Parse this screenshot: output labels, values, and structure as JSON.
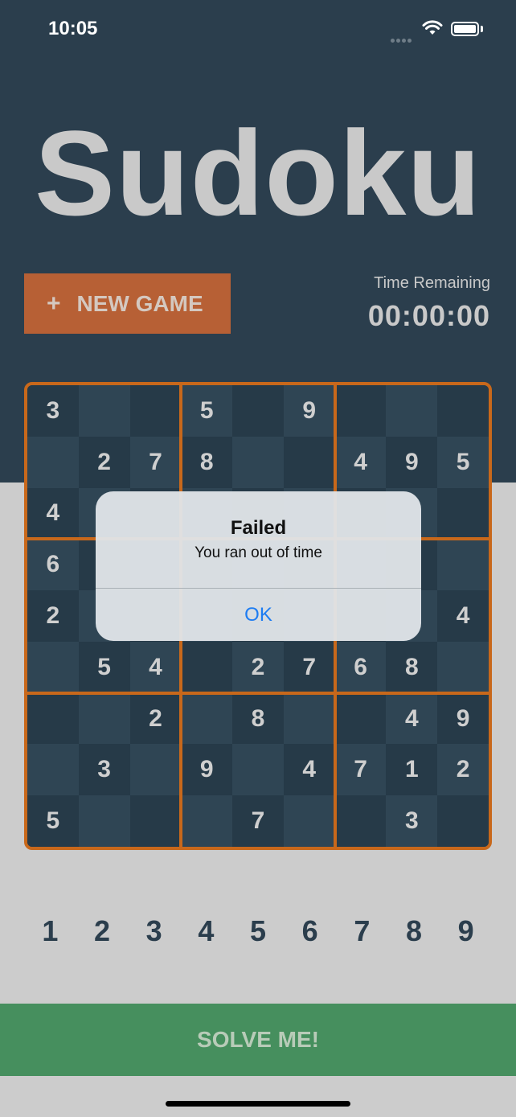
{
  "status_bar": {
    "time": "10:05"
  },
  "app": {
    "title": "Sudoku"
  },
  "controls": {
    "new_game_icon": "+",
    "new_game_label": "NEW GAME",
    "timer_label": "Time Remaining",
    "timer_value": "00:00:00"
  },
  "board": {
    "rows": [
      [
        "3",
        "",
        "",
        "5",
        "",
        "9",
        "",
        "",
        ""
      ],
      [
        "",
        "2",
        "7",
        "8",
        "",
        "",
        "4",
        "9",
        "5"
      ],
      [
        "4",
        "",
        "",
        "",
        "",
        "",
        "",
        "",
        ""
      ],
      [
        "6",
        "",
        "",
        "",
        "",
        "",
        "",
        "",
        ""
      ],
      [
        "2",
        "",
        "",
        "",
        "",
        "",
        "",
        "",
        "4"
      ],
      [
        "",
        "5",
        "4",
        "",
        "2",
        "7",
        "6",
        "8",
        ""
      ],
      [
        "",
        "",
        "2",
        "",
        "8",
        "",
        "",
        "4",
        "9"
      ],
      [
        "",
        "3",
        "",
        "9",
        "",
        "4",
        "7",
        "1",
        "2"
      ],
      [
        "5",
        "",
        "",
        "",
        "7",
        "",
        "",
        "3",
        ""
      ]
    ]
  },
  "alert": {
    "title": "Failed",
    "message": "You ran out of time",
    "ok_label": "OK"
  },
  "numpad": {
    "keys": [
      "1",
      "2",
      "3",
      "4",
      "5",
      "6",
      "7",
      "8",
      "9"
    ]
  },
  "solve": {
    "label": "SOLVE ME!"
  },
  "colors": {
    "header_bg": "#2b3e4d",
    "accent_orange": "#b76035",
    "board_border": "#c8681b",
    "solve_green": "#468f5e",
    "link_blue": "#1d7cf2"
  }
}
